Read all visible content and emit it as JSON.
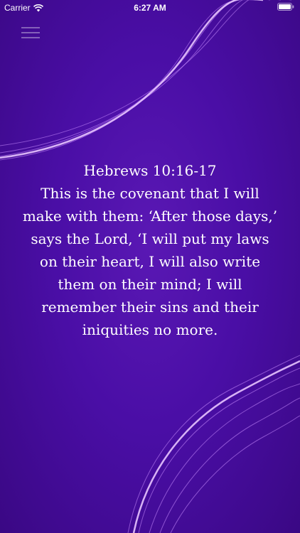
{
  "status_bar": {
    "carrier": "Carrier",
    "time": "6:27 AM",
    "wifi_icon": "wifi-icon",
    "battery_icon": "battery-icon"
  },
  "menu": {
    "icon": "hamburger-menu-icon"
  },
  "verse": {
    "reference": "Hebrews 10:16-17",
    "text": "This is the covenant that I will make with them: ‘After those days,’ says the Lord, ‘I will put my laws on their heart, I will also write them on their mind; I will remember their sins and their iniquities no more."
  },
  "colors": {
    "background": "#4a0ea6",
    "wave": "#c98cff",
    "text": "#ffffff"
  }
}
